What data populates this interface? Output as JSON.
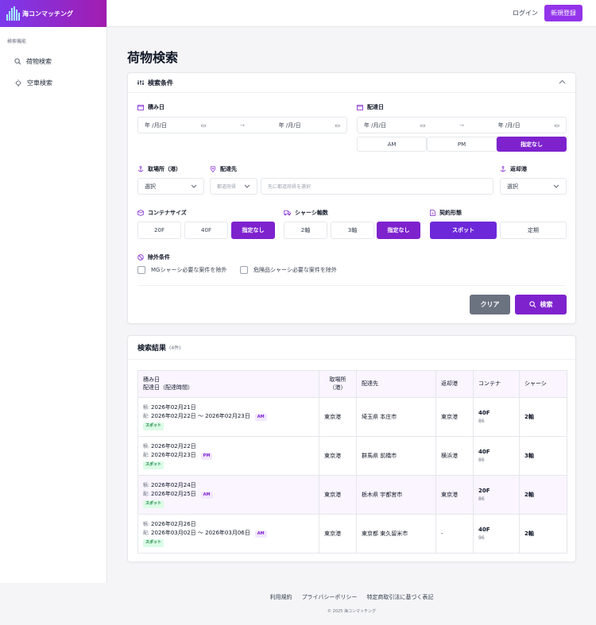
{
  "brand": {
    "name": "海コンマッチング"
  },
  "sidebar": {
    "section_label": "検索機能",
    "items": [
      {
        "label": "荷物検索",
        "icon": "search-icon"
      },
      {
        "label": "空車検索",
        "icon": "lightbulb-icon"
      }
    ]
  },
  "topbar": {
    "login": "ログイン",
    "register": "新規登録"
  },
  "page": {
    "title": "荷物検索"
  },
  "search": {
    "header": "検索条件",
    "loading_date": {
      "label": "積み日",
      "from": "年 /月/日",
      "to": "年 /月/日"
    },
    "delivery_date": {
      "label": "配達日",
      "from": "年 /月/日",
      "to": "年 /月/日",
      "options": [
        "AM",
        "PM",
        "指定なし"
      ],
      "selected": "指定なし"
    },
    "pickup_port": {
      "label": "取場所（港）",
      "value": "選択"
    },
    "destination": {
      "label": "配達先",
      "prefecture_placeholder": "都道府県",
      "city_placeholder": "先に都道府県を選択"
    },
    "return_port": {
      "label": "返却港",
      "value": "選択"
    },
    "container_size": {
      "label": "コンテナサイズ",
      "options": [
        "20F",
        "40F",
        "指定なし"
      ],
      "selected": "指定なし"
    },
    "chassis_axles": {
      "label": "シャーシ軸数",
      "options": [
        "2軸",
        "3軸",
        "指定なし"
      ],
      "selected": "指定なし"
    },
    "contract_type": {
      "label": "契約形態",
      "options": [
        "スポット",
        "定期"
      ],
      "selected": "スポット"
    },
    "exclusions": {
      "label": "除外条件",
      "options": [
        "MGシャーシ必要な案件を除外",
        "危険品シャーシ必要な案件を除外"
      ]
    },
    "clear_label": "クリア",
    "search_label": "検索"
  },
  "results": {
    "title": "検索結果",
    "count": "(4件)",
    "columns": [
      "積み日",
      "配達日（配達時間）",
      "取場所（港）",
      "配達先",
      "返却港",
      "コンテナ",
      "シャーシ"
    ],
    "rows": [
      {
        "load_prefix": "積:",
        "load": "2026年02月21日",
        "del_prefix": "配:",
        "delivery": "2026年02月22日 〜 2026年02月23日",
        "slot": "AM",
        "contract": "スポット",
        "port": "東京港",
        "dest": "埼玉県 本庄市",
        "return": "東京港",
        "size": "40F",
        "size_sub": "86",
        "chassis": "2軸"
      },
      {
        "load_prefix": "積:",
        "load": "2026年02月22日",
        "del_prefix": "配:",
        "delivery": "2026年02月23日",
        "slot": "PM",
        "contract": "スポット",
        "port": "東京港",
        "dest": "群馬県 前橋市",
        "return": "横浜港",
        "size": "40F",
        "size_sub": "86",
        "chassis": "3軸"
      },
      {
        "load_prefix": "積:",
        "load": "2026年02月24日",
        "del_prefix": "配:",
        "delivery": "2026年02月25日",
        "slot": "AM",
        "contract": "スポット",
        "port": "東京港",
        "dest": "栃木県 宇都宮市",
        "return": "東京港",
        "size": "20F",
        "size_sub": "86",
        "chassis": "2軸"
      },
      {
        "load_prefix": "積:",
        "load": "2026年02月26日",
        "del_prefix": "配:",
        "delivery": "2026年03月02日 〜 2026年03月06日",
        "slot": "AM",
        "contract": "スポット",
        "port": "東京港",
        "dest": "東京都 東久留米市",
        "return": "-",
        "size": "40F",
        "size_sub": "96",
        "chassis": "2軸"
      }
    ]
  },
  "footer": {
    "links": [
      "利用規約",
      "プライバシーポリシー",
      "特定商取引法に基づく表記"
    ],
    "copyright": "© 2025 海コンマッチング"
  },
  "colors": {
    "accent": "#7e22ce",
    "brand_gradient_start": "#7c3aed",
    "brand_gradient_end": "#a21caf",
    "clear_button": "#6b7280"
  }
}
